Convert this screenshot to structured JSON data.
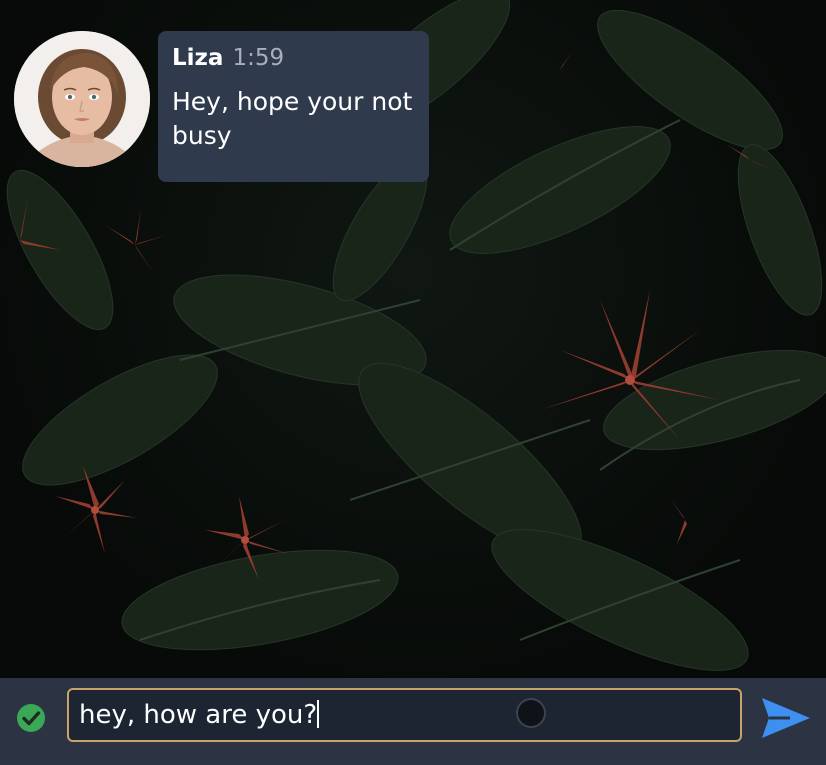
{
  "conversation": {
    "messages": [
      {
        "sender": "Liza",
        "time": "1:59",
        "text": "Hey, hope your not busy"
      }
    ]
  },
  "composer": {
    "draft": "hey, how are you?",
    "status_icon": "check-circle-icon",
    "send_icon": "send-icon"
  },
  "colors": {
    "bubble": "#2f3a4d",
    "composer_bar": "#2c3444",
    "input_border": "#c9a46a",
    "status_green": "#3aa856",
    "send_blue": "#3d8ff0"
  }
}
